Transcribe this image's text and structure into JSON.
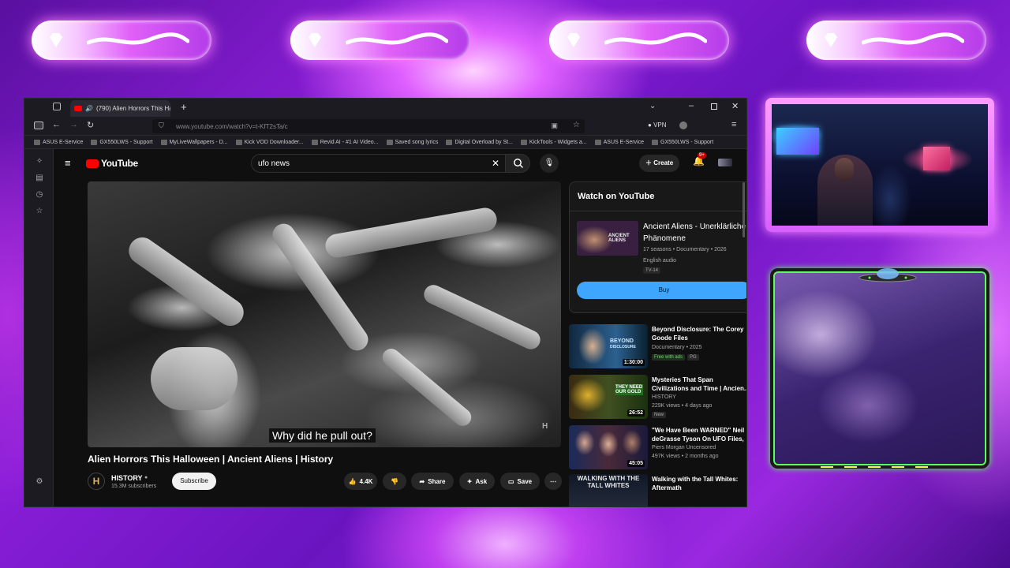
{
  "browser": {
    "tab_title": "(790) Alien Horrors This Hal",
    "url": "www.youtube.com/watch?v=t-KfT2sTa/c",
    "vpn_label": "VPN",
    "bookmarks": [
      "ASUS E-Service",
      "GX550LWS - Support",
      "MyLiveWallpapers - D...",
      "Kick VOD Downloader...",
      "Revid AI - #1 AI Video...",
      "Saved song lyrics",
      "Digital Overload by St...",
      "KickTools - Widgets a...",
      "ASUS E-Service",
      "GX550LWS - Support"
    ]
  },
  "youtube": {
    "logo_text": "YouTube",
    "search_value": "ufo news",
    "create_label": "Create",
    "notif_count": "9+",
    "caption": "Why did he pull out?",
    "video_title": "Alien Horrors This Halloween | Ancient Aliens | History",
    "channel": {
      "name": "HISTORY",
      "subscribers": "15.3M subscribers",
      "subscribe_label": "Subscribe"
    },
    "actions": {
      "likes": "4.4K",
      "share": "Share",
      "ask": "Ask",
      "save": "Save"
    },
    "watch_panel": {
      "header": "Watch on YouTube",
      "title": "Ancient Aliens - Unerklärliche Phänomene",
      "meta": "17 seasons • Documentary • 2026",
      "audio": "English audio",
      "rating": "TV-14",
      "buy_label": "Buy"
    },
    "recommendations": [
      {
        "title": "Beyond Disclosure: The Corey Goode Files",
        "meta1": "Documentary • 2025",
        "tag1": "Free with ads",
        "tag2": "PG",
        "duration": "1:30:00"
      },
      {
        "title": "Mysteries That Span Civilizations and Time | Ancien...",
        "meta1": "HISTORY",
        "meta2": "229K views • 4 days ago",
        "tag1": "New",
        "duration": "26:52"
      },
      {
        "title": "\"We Have Been WARNED\" Neil deGrasse Tyson On UFO Files, ...",
        "meta1": "Piers Morgan Uncensored",
        "meta2": "497K views • 2 months ago",
        "duration": "45:05"
      },
      {
        "title": "Walking with the Tall Whites: Aftermath",
        "thumb_text": "WALKING WITH THE TALL WHITES"
      }
    ]
  },
  "colors": {
    "accent": "#3ea6ff",
    "youtube_red": "#ff0000",
    "overlay_purple": "#9a28e0",
    "chat_green": "#5aff5a"
  }
}
